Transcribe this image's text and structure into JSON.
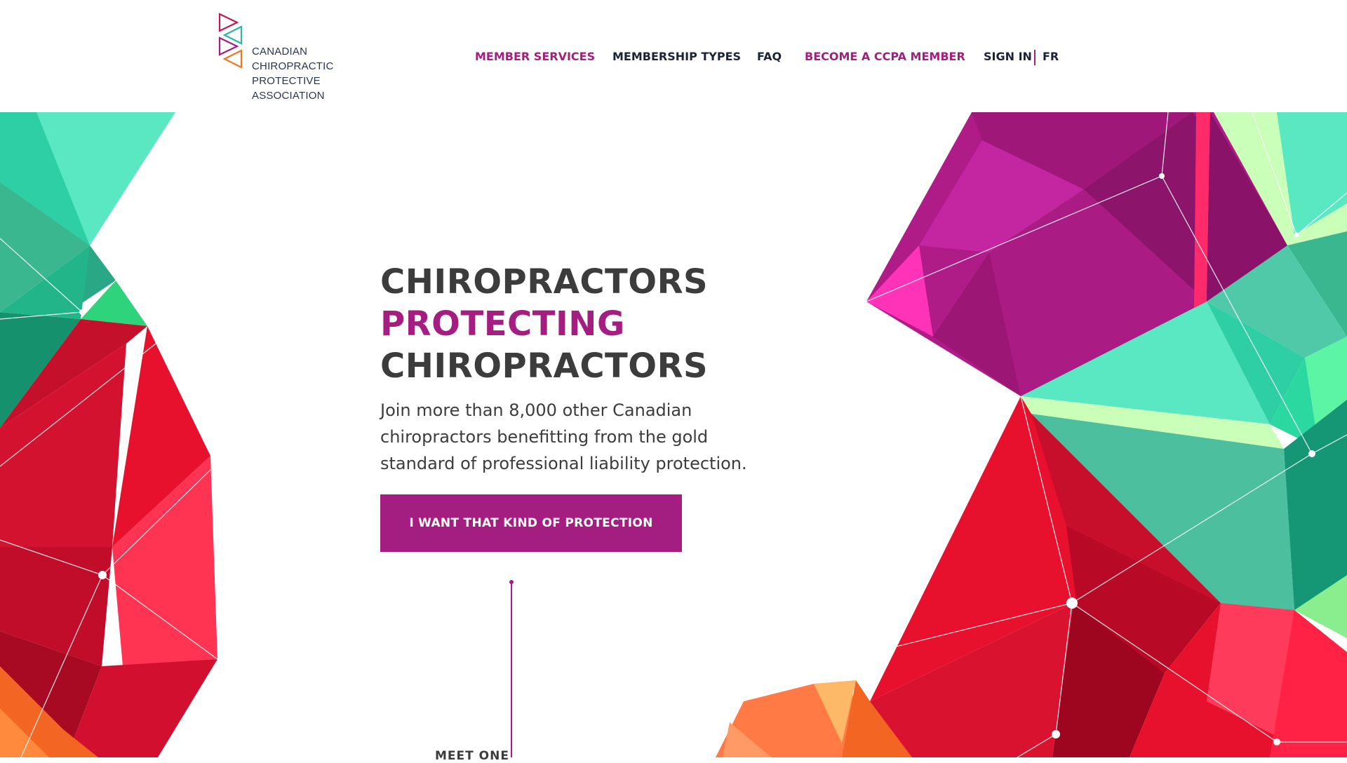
{
  "brand": {
    "name_lines": [
      "CANADIAN",
      "CHIROPRACTIC",
      "PROTECTIVE",
      "ASSOCIATION"
    ],
    "logo_colors": [
      "#c8174f",
      "#2cb6a4",
      "#a41e82",
      "#f07524"
    ]
  },
  "nav": {
    "items": [
      {
        "label": "MEMBER SERVICES"
      },
      {
        "label": "MEMBERSHIP TYPES"
      },
      {
        "label": "FAQ"
      },
      {
        "label": "BECOME A CCPA MEMBER"
      },
      {
        "label": "SIGN IN"
      },
      {
        "label": "FR"
      }
    ]
  },
  "hero": {
    "title_line1": "CHIROPRACTORS",
    "title_line2": "PROTECTING",
    "title_line3": "CHIROPRACTORS",
    "subtitle": "Join more than 8,000 other Canadian chiropractors benefitting from the gold standard of professional liability protection.",
    "cta_label": "I WANT THAT KIND OF PROTECTION"
  },
  "scroll": {
    "label": "MEET ONE"
  },
  "colors": {
    "accent": "#a41e82",
    "text_dark": "#3c3c3c",
    "nav_dark": "#1b2436",
    "red": "#e8112d",
    "teal": "#2ecfa5",
    "magenta": "#b01c87",
    "orange": "#f26522"
  }
}
